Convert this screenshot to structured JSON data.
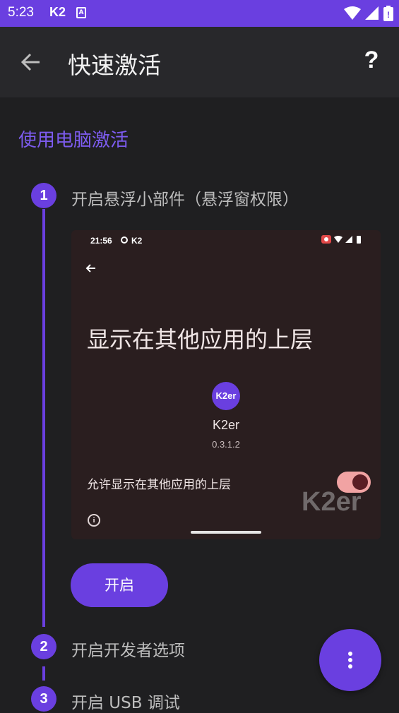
{
  "status_bar": {
    "time": "5:23",
    "carrier": "K2",
    "notif": "A",
    "icons": [
      "wifi-icon",
      "signal-icon",
      "battery-icon"
    ]
  },
  "app_bar": {
    "title": "快速激活",
    "back_icon": "arrow-left-icon",
    "help_label": "?"
  },
  "section_title": "使用电脑激活",
  "steps": [
    {
      "number": "1",
      "label": "开启悬浮小部件（悬浮窗权限）"
    },
    {
      "number": "2",
      "label": "开启开发者选项"
    },
    {
      "number": "3",
      "label": "开启 USB 调试"
    }
  ],
  "preview": {
    "time": "21:56",
    "carrier": "K2",
    "heading": "显示在其他应用的上层",
    "logo_text": "K2er",
    "app_name": "K2er",
    "version": "0.3.1.2",
    "allow_label": "允许显示在其他应用的上层",
    "toggle_on": true,
    "watermark": "K2er",
    "info_icon": "i"
  },
  "enable_button": "开启",
  "fab_icon": "more-vert-icon",
  "colors": {
    "accent": "#6a3fe0",
    "background": "#1f1f21",
    "appbar": "#28282b",
    "section_title": "#7d5cf0"
  }
}
